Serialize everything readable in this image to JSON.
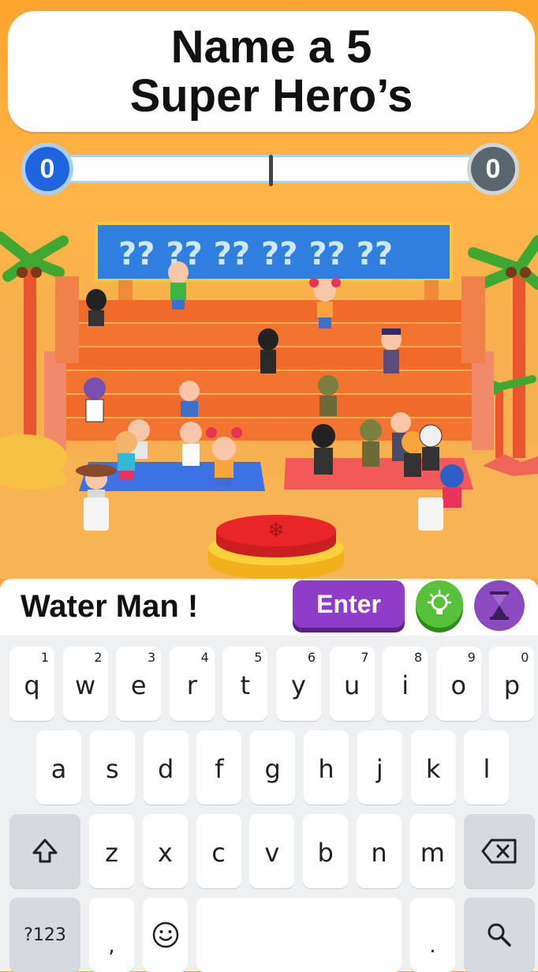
{
  "question": {
    "line1": "Name a 5",
    "line2": "Super Hero’s"
  },
  "score": {
    "left": "0",
    "right": "0",
    "left_color": "#1e63e0",
    "right_color": "#5a666d"
  },
  "input": {
    "value": "Water Man !"
  },
  "buttons": {
    "enter_label": "Enter",
    "hint_icon": "lightbulb-icon",
    "timer_icon": "hourglass-icon"
  },
  "colors": {
    "enter": "#8f3cc8",
    "hint": "#55c23a",
    "timer": "#8c4ac1",
    "buzzer": "#e8262a"
  },
  "keyboard": {
    "row1": [
      {
        "key": "q",
        "hint": "1"
      },
      {
        "key": "w",
        "hint": "2"
      },
      {
        "key": "e",
        "hint": "3"
      },
      {
        "key": "r",
        "hint": "4"
      },
      {
        "key": "t",
        "hint": "5"
      },
      {
        "key": "y",
        "hint": "6"
      },
      {
        "key": "u",
        "hint": "7"
      },
      {
        "key": "i",
        "hint": "8"
      },
      {
        "key": "o",
        "hint": "9"
      },
      {
        "key": "p",
        "hint": "0"
      }
    ],
    "row2": [
      "a",
      "s",
      "d",
      "f",
      "g",
      "h",
      "j",
      "k",
      "l"
    ],
    "row3": [
      "z",
      "x",
      "c",
      "v",
      "b",
      "n",
      "m"
    ],
    "symbols": "?123",
    "comma": ",",
    "period": ".",
    "shift_icon": "shift-icon",
    "backspace_icon": "backspace-icon",
    "emoji_icon": "emoji-icon",
    "search_icon": "search-icon"
  }
}
